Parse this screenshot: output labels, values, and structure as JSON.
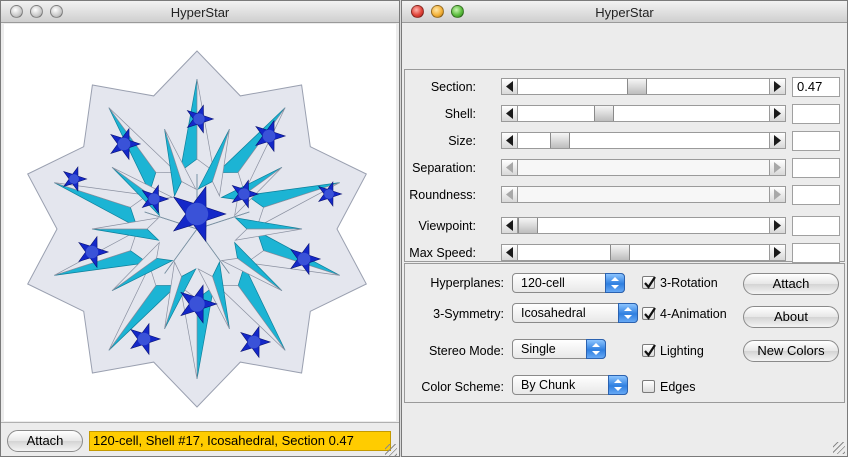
{
  "left_window": {
    "title": "HyperStar",
    "attach_button": "Attach",
    "status_text": "120-cell, Shell #17, Icosahedral, Section 0.47"
  },
  "right_window": {
    "title": "HyperStar",
    "sliders": [
      {
        "label": "Section:",
        "value_text": "0.47",
        "position": 0.47,
        "enabled": true
      },
      {
        "label": "Shell:",
        "value_text": "",
        "position": 0.33,
        "enabled": true
      },
      {
        "label": "Size:",
        "value_text": "",
        "position": 0.14,
        "enabled": true
      },
      {
        "label": "Separation:",
        "value_text": "",
        "position": null,
        "enabled": false
      },
      {
        "label": "Roundness:",
        "value_text": "",
        "position": null,
        "enabled": false
      },
      {
        "label": "Viewpoint:",
        "value_text": "",
        "position": 0.0,
        "enabled": true
      },
      {
        "label": "Max Speed:",
        "value_text": "",
        "position": 0.4,
        "enabled": true
      }
    ],
    "controls": {
      "hyperplanes_label": "Hyperplanes:",
      "hyperplanes_value": "120-cell",
      "symmetry_label": "3-Symmetry:",
      "symmetry_value": "Icosahedral",
      "stereo_label": "Stereo Mode:",
      "stereo_value": "Single",
      "color_label": "Color Scheme:",
      "color_value": "By Chunk"
    },
    "checkboxes": {
      "rotation": {
        "label": "3-Rotation",
        "checked": true
      },
      "animation": {
        "label": "4-Animation",
        "checked": true
      },
      "lighting": {
        "label": "Lighting",
        "checked": true
      },
      "edges": {
        "label": "Edges",
        "checked": false
      }
    },
    "buttons": {
      "attach": "Attach",
      "about": "About",
      "new_colors": "New Colors"
    }
  },
  "colors": {
    "cyan": "#1cb4d4",
    "blue": "#1428c8",
    "white": "#e4e6ee",
    "status_bg": "#ffcc00"
  }
}
